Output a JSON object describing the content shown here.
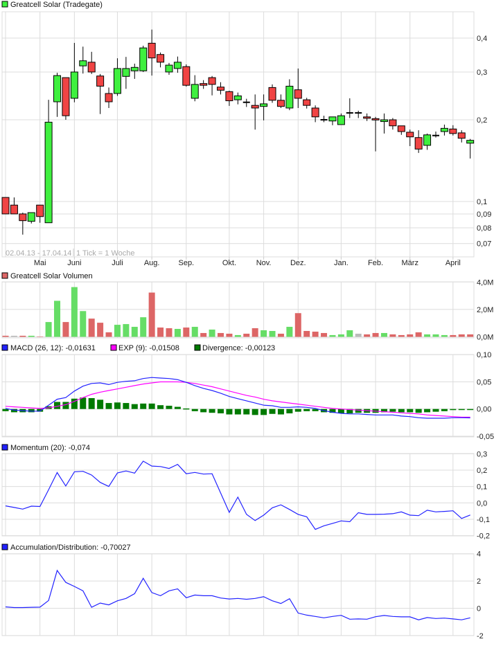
{
  "colors": {
    "up": "#3ff03f",
    "down": "#f04444",
    "vol_up": "#66dd66",
    "vol_down": "#dd6666",
    "vol_flat": "#bbbbbb",
    "macd": "#2222ff",
    "exp": "#ff00ff",
    "divergence": "#007a00",
    "momentum": "#2222ff",
    "ad": "#2222ff"
  },
  "price_panel": {
    "legend": "Greatcell Solar (Tradegate)",
    "range_label": "02.04.13 - 17.04.14",
    "tick_label": "1 Tick = 1 Woche"
  },
  "volume_panel": {
    "legend": "Greatcell Solar Volumen"
  },
  "macd_panel": {
    "macd_legend": "MACD (26, 12): -0,01631",
    "exp_legend": "EXP (9): -0,01508",
    "div_legend": "Divergence: -0,00123"
  },
  "momentum_panel": {
    "legend": "Momentum (20): -0,074"
  },
  "ad_panel": {
    "legend": "Accumulation/Distribution: -0,70027"
  },
  "chart_data": [
    {
      "type": "candlestick",
      "title": "Greatcell Solar (Tradegate)",
      "scale": "log",
      "ylim": [
        0.0626,
        0.5
      ],
      "yticks": [
        {
          "v": 0.4,
          "label": "0,4"
        },
        {
          "v": 0.3,
          "label": "0,3"
        },
        {
          "v": 0.2,
          "label": "0,2"
        },
        {
          "v": 0.1,
          "label": "0,1"
        },
        {
          "v": 0.09,
          "label": "0,09"
        },
        {
          "v": 0.08,
          "label": "0,08"
        },
        {
          "v": 0.07,
          "label": "0,07"
        }
      ],
      "xticks": [
        {
          "i": 4,
          "label": "Mai"
        },
        {
          "i": 8,
          "label": "Juni"
        },
        {
          "i": 13,
          "label": "Juli"
        },
        {
          "i": 17,
          "label": "Aug."
        },
        {
          "i": 21,
          "label": "Sep."
        },
        {
          "i": 26,
          "label": "Okt."
        },
        {
          "i": 30,
          "label": "Nov."
        },
        {
          "i": 34,
          "label": "Dez."
        },
        {
          "i": 39,
          "label": "Jan."
        },
        {
          "i": 43,
          "label": "Feb."
        },
        {
          "i": 47,
          "label": "März"
        },
        {
          "i": 52,
          "label": "April"
        }
      ],
      "ohlc": [
        [
          0.1035,
          0.1035,
          0.09,
          0.09
        ],
        [
          0.097,
          0.1035,
          0.09,
          0.09
        ],
        [
          0.09,
          0.091,
          0.0755,
          0.085
        ],
        [
          0.0845,
          0.091,
          0.083,
          0.091
        ],
        [
          0.097,
          0.097,
          0.0835,
          0.088
        ],
        [
          0.0835,
          0.237,
          0.0835,
          0.196
        ],
        [
          0.233,
          0.298,
          0.205,
          0.291
        ],
        [
          0.286,
          0.286,
          0.2,
          0.207
        ],
        [
          0.24,
          0.384,
          0.232,
          0.3
        ],
        [
          0.316,
          0.372,
          0.296,
          0.33
        ],
        [
          0.326,
          0.356,
          0.295,
          0.3
        ],
        [
          0.29,
          0.295,
          0.21,
          0.266
        ],
        [
          0.25,
          0.263,
          0.221,
          0.233
        ],
        [
          0.25,
          0.337,
          0.245,
          0.309
        ],
        [
          0.289,
          0.341,
          0.26,
          0.309
        ],
        [
          0.303,
          0.322,
          0.283,
          0.312
        ],
        [
          0.303,
          0.375,
          0.3,
          0.368
        ],
        [
          0.383,
          0.43,
          0.291,
          0.338
        ],
        [
          0.348,
          0.354,
          0.312,
          0.326
        ],
        [
          0.3,
          0.324,
          0.293,
          0.318
        ],
        [
          0.309,
          0.342,
          0.298,
          0.326
        ],
        [
          0.314,
          0.32,
          0.265,
          0.268
        ],
        [
          0.24,
          0.292,
          0.234,
          0.27
        ],
        [
          0.272,
          0.28,
          0.26,
          0.268
        ],
        [
          0.286,
          0.29,
          0.246,
          0.27
        ],
        [
          0.264,
          0.275,
          0.248,
          0.257
        ],
        [
          0.254,
          0.256,
          0.225,
          0.235
        ],
        [
          0.237,
          0.252,
          0.228,
          0.245
        ],
        [
          0.232,
          0.239,
          0.223,
          0.232
        ],
        [
          0.226,
          0.248,
          0.184,
          0.221
        ],
        [
          0.224,
          0.248,
          0.199,
          0.229
        ],
        [
          0.263,
          0.27,
          0.231,
          0.236
        ],
        [
          0.236,
          0.248,
          0.221,
          0.224
        ],
        [
          0.221,
          0.282,
          0.217,
          0.266
        ],
        [
          0.258,
          0.309,
          0.221,
          0.24
        ],
        [
          0.237,
          0.241,
          0.22,
          0.226
        ],
        [
          0.221,
          0.226,
          0.196,
          0.205
        ],
        [
          0.2,
          0.207,
          0.196,
          0.2
        ],
        [
          0.198,
          0.205,
          0.191,
          0.205
        ],
        [
          0.192,
          0.211,
          0.192,
          0.207
        ],
        [
          0.212,
          0.24,
          0.203,
          0.212
        ],
        [
          0.212,
          0.216,
          0.203,
          0.212
        ],
        [
          0.205,
          0.211,
          0.198,
          0.203
        ],
        [
          0.202,
          0.205,
          0.153,
          0.2
        ],
        [
          0.197,
          0.211,
          0.178,
          0.2
        ],
        [
          0.2,
          0.203,
          0.184,
          0.19
        ],
        [
          0.19,
          0.19,
          0.176,
          0.181
        ],
        [
          0.18,
          0.184,
          0.16,
          0.173
        ],
        [
          0.172,
          0.183,
          0.151,
          0.156
        ],
        [
          0.161,
          0.178,
          0.155,
          0.176
        ],
        [
          0.175,
          0.181,
          0.172,
          0.175
        ],
        [
          0.181,
          0.192,
          0.175,
          0.186
        ],
        [
          0.185,
          0.191,
          0.175,
          0.178
        ],
        [
          0.179,
          0.183,
          0.165,
          0.171
        ],
        [
          0.164,
          0.17,
          0.144,
          0.168
        ]
      ]
    },
    {
      "type": "bar",
      "title": "Greatcell Solar Volumen",
      "unit": "M",
      "ylim": [
        0,
        4
      ],
      "yticks": [
        {
          "v": 4,
          "label": "4,0M"
        },
        {
          "v": 2,
          "label": "2,0M"
        },
        {
          "v": 0,
          "label": "0,0M"
        }
      ],
      "values": [
        0.08,
        0.08,
        0.08,
        0.08,
        0.03,
        1.08,
        2.63,
        1.08,
        3.63,
        1.88,
        1.33,
        1.03,
        0.33,
        0.88,
        0.93,
        0.73,
        1.43,
        3.23,
        0.68,
        0.63,
        0.58,
        0.68,
        0.73,
        0.28,
        0.53,
        0.28,
        0.23,
        0.13,
        0.23,
        0.63,
        0.48,
        0.43,
        0.23,
        0.73,
        1.73,
        0.43,
        0.38,
        0.28,
        0.13,
        0.18,
        0.48,
        0.23,
        0.18,
        0.28,
        0.28,
        0.18,
        0.13,
        0.18,
        0.33,
        0.18,
        0.18,
        0.13,
        0.13,
        0.18,
        0.18
      ],
      "direction": [
        "down",
        "flat",
        "down",
        "up",
        "down",
        "up",
        "up",
        "down",
        "up",
        "up",
        "down",
        "down",
        "down",
        "up",
        "up",
        "up",
        "up",
        "down",
        "down",
        "down",
        "up",
        "down",
        "up",
        "down",
        "up",
        "down",
        "down",
        "up",
        "down",
        "down",
        "up",
        "up",
        "down",
        "up",
        "down",
        "down",
        "down",
        "down",
        "up",
        "up",
        "up",
        "flat",
        "down",
        "down",
        "up",
        "down",
        "down",
        "down",
        "down",
        "up",
        "up",
        "up",
        "down",
        "down",
        "down"
      ]
    },
    {
      "type": "line",
      "title": "MACD",
      "ylim": [
        -0.05,
        0.1
      ],
      "yticks": [
        {
          "v": 0.1,
          "label": "0,10"
        },
        {
          "v": 0.05,
          "label": "0,05"
        },
        {
          "v": 0,
          "label": "0,00"
        },
        {
          "v": -0.05,
          "label": "-0,05"
        }
      ],
      "series": [
        {
          "name": "MACD (26, 12)",
          "values": [
            0.001,
            -0.002,
            -0.003,
            -0.004,
            -0.004,
            0.007,
            0.018,
            0.021,
            0.033,
            0.042,
            0.047,
            0.048,
            0.045,
            0.049,
            0.051,
            0.052,
            0.056,
            0.058,
            0.057,
            0.056,
            0.054,
            0.049,
            0.043,
            0.038,
            0.034,
            0.029,
            0.023,
            0.019,
            0.015,
            0.011,
            0.007,
            0.006,
            0.003,
            0.003,
            0.004,
            0.003,
            0.001,
            -0.003,
            -0.006,
            -0.008,
            -0.009,
            -0.009,
            -0.01,
            -0.011,
            -0.011,
            -0.011,
            -0.013,
            -0.014,
            -0.016,
            -0.017,
            -0.017,
            -0.017,
            -0.016,
            -0.016,
            -0.01631
          ]
        },
        {
          "name": "EXP (9)",
          "values": [
            0.005,
            0.004,
            0.003,
            0.002,
            0.001,
            0.002,
            0.005,
            0.008,
            0.014,
            0.021,
            0.027,
            0.031,
            0.034,
            0.037,
            0.04,
            0.043,
            0.046,
            0.048,
            0.05,
            0.05,
            0.05,
            0.049,
            0.047,
            0.044,
            0.041,
            0.037,
            0.033,
            0.029,
            0.025,
            0.022,
            0.018,
            0.015,
            0.013,
            0.011,
            0.009,
            0.007,
            0.005,
            0.003,
            0.001,
            0,
            -0.001,
            -0.002,
            -0.003,
            -0.004,
            -0.005,
            -0.006,
            -0.007,
            -0.008,
            -0.009,
            -0.011,
            -0.012,
            -0.013,
            -0.014,
            -0.015,
            -0.01508
          ]
        },
        {
          "name": "Divergence",
          "type": "bar",
          "values": [
            -0.004,
            -0.006,
            -0.006,
            -0.006,
            -0.005,
            0.005,
            0.013,
            0.013,
            0.019,
            0.021,
            0.02,
            0.017,
            0.011,
            0.012,
            0.011,
            0.009,
            0.01,
            0.01,
            0.007,
            0.006,
            0.004,
            0.001,
            -0.004,
            -0.006,
            -0.007,
            -0.008,
            -0.01,
            -0.01,
            -0.01,
            -0.011,
            -0.011,
            -0.009,
            -0.01,
            -0.008,
            -0.005,
            -0.004,
            -0.004,
            -0.006,
            -0.007,
            -0.008,
            -0.008,
            -0.007,
            -0.007,
            -0.007,
            -0.006,
            -0.005,
            -0.006,
            -0.006,
            -0.007,
            -0.006,
            -0.005,
            -0.004,
            -0.002,
            -0.001,
            -0.00123
          ]
        }
      ]
    },
    {
      "type": "line",
      "title": "Momentum (20)",
      "ylim": [
        -0.2,
        0.3
      ],
      "yticks": [
        {
          "v": 0.3,
          "label": "0,3"
        },
        {
          "v": 0.2,
          "label": "0,2"
        },
        {
          "v": 0.1,
          "label": "0,1"
        },
        {
          "v": 0,
          "label": "0,0"
        },
        {
          "v": -0.1,
          "label": "-0,1"
        },
        {
          "v": -0.2,
          "label": "-0,2"
        }
      ],
      "values": [
        -0.018,
        -0.028,
        -0.038,
        -0.02,
        -0.022,
        0.08,
        0.185,
        0.103,
        0.19,
        0.193,
        0.17,
        0.125,
        0.1,
        0.183,
        0.195,
        0.182,
        0.255,
        0.225,
        0.222,
        0.21,
        0.235,
        0.178,
        0.186,
        0.176,
        0.178,
        0.06,
        -0.058,
        0.035,
        -0.07,
        -0.108,
        -0.075,
        -0.03,
        -0.012,
        -0.04,
        -0.07,
        -0.085,
        -0.162,
        -0.14,
        -0.125,
        -0.11,
        -0.115,
        -0.06,
        -0.07,
        -0.07,
        -0.069,
        -0.066,
        -0.055,
        -0.075,
        -0.078,
        -0.045,
        -0.055,
        -0.052,
        -0.048,
        -0.095,
        -0.074
      ]
    },
    {
      "type": "line",
      "title": "Accumulation/Distribution",
      "ylim": [
        -2,
        4
      ],
      "yticks": [
        {
          "v": 4,
          "label": "4"
        },
        {
          "v": 2,
          "label": "2"
        },
        {
          "v": 0,
          "label": "0"
        },
        {
          "v": -2,
          "label": "-2"
        }
      ],
      "values": [
        0.1,
        0.05,
        0.05,
        0.07,
        0.08,
        0.57,
        2.77,
        1.9,
        1.6,
        1.28,
        0.07,
        0.38,
        0.25,
        0.55,
        0.72,
        1.07,
        2.2,
        1.15,
        0.92,
        1.28,
        1.42,
        0.77,
        0.97,
        0.92,
        0.92,
        0.75,
        0.68,
        0.72,
        0.66,
        0.72,
        0.85,
        0.55,
        0.35,
        0.7,
        -0.35,
        -0.5,
        -0.6,
        -0.7,
        -0.6,
        -0.52,
        -0.8,
        -0.78,
        -0.8,
        -0.62,
        -0.53,
        -0.6,
        -0.63,
        -0.63,
        -0.85,
        -0.68,
        -0.75,
        -0.72,
        -0.78,
        -0.85,
        -0.70027
      ]
    }
  ]
}
